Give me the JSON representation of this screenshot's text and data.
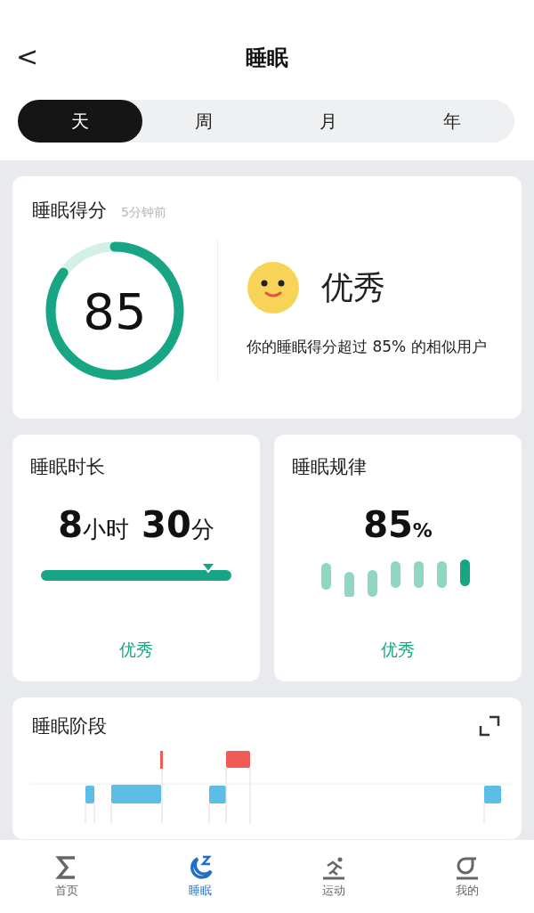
{
  "header": {
    "back": "<",
    "title": "睡眠"
  },
  "tabs": [
    {
      "label": "天",
      "selected": true
    },
    {
      "label": "周",
      "selected": false
    },
    {
      "label": "月",
      "selected": false
    },
    {
      "label": "年",
      "selected": false
    }
  ],
  "score_card": {
    "title": "睡眠得分",
    "time": "5分钟前",
    "score": "85",
    "level": 0.85,
    "rating": "优秀",
    "description": "你的睡眠得分超过 85% 的相似用户"
  },
  "duration_card": {
    "title": "睡眠时长",
    "hours": "8",
    "hours_unit": "小时",
    "minutes": "30",
    "minutes_unit": "分",
    "level": 0.88,
    "rating": "优秀"
  },
  "regularity_card": {
    "title": "睡眠规律",
    "value": "85",
    "unit": "%",
    "rating": "优秀"
  },
  "stages_card": {
    "title": "睡眠阶段"
  },
  "bottom_nav": [
    {
      "label": "首页",
      "selected": false
    },
    {
      "label": "睡眠",
      "selected": true
    },
    {
      "label": "运动",
      "selected": false
    },
    {
      "label": "我的",
      "selected": false
    }
  ]
}
